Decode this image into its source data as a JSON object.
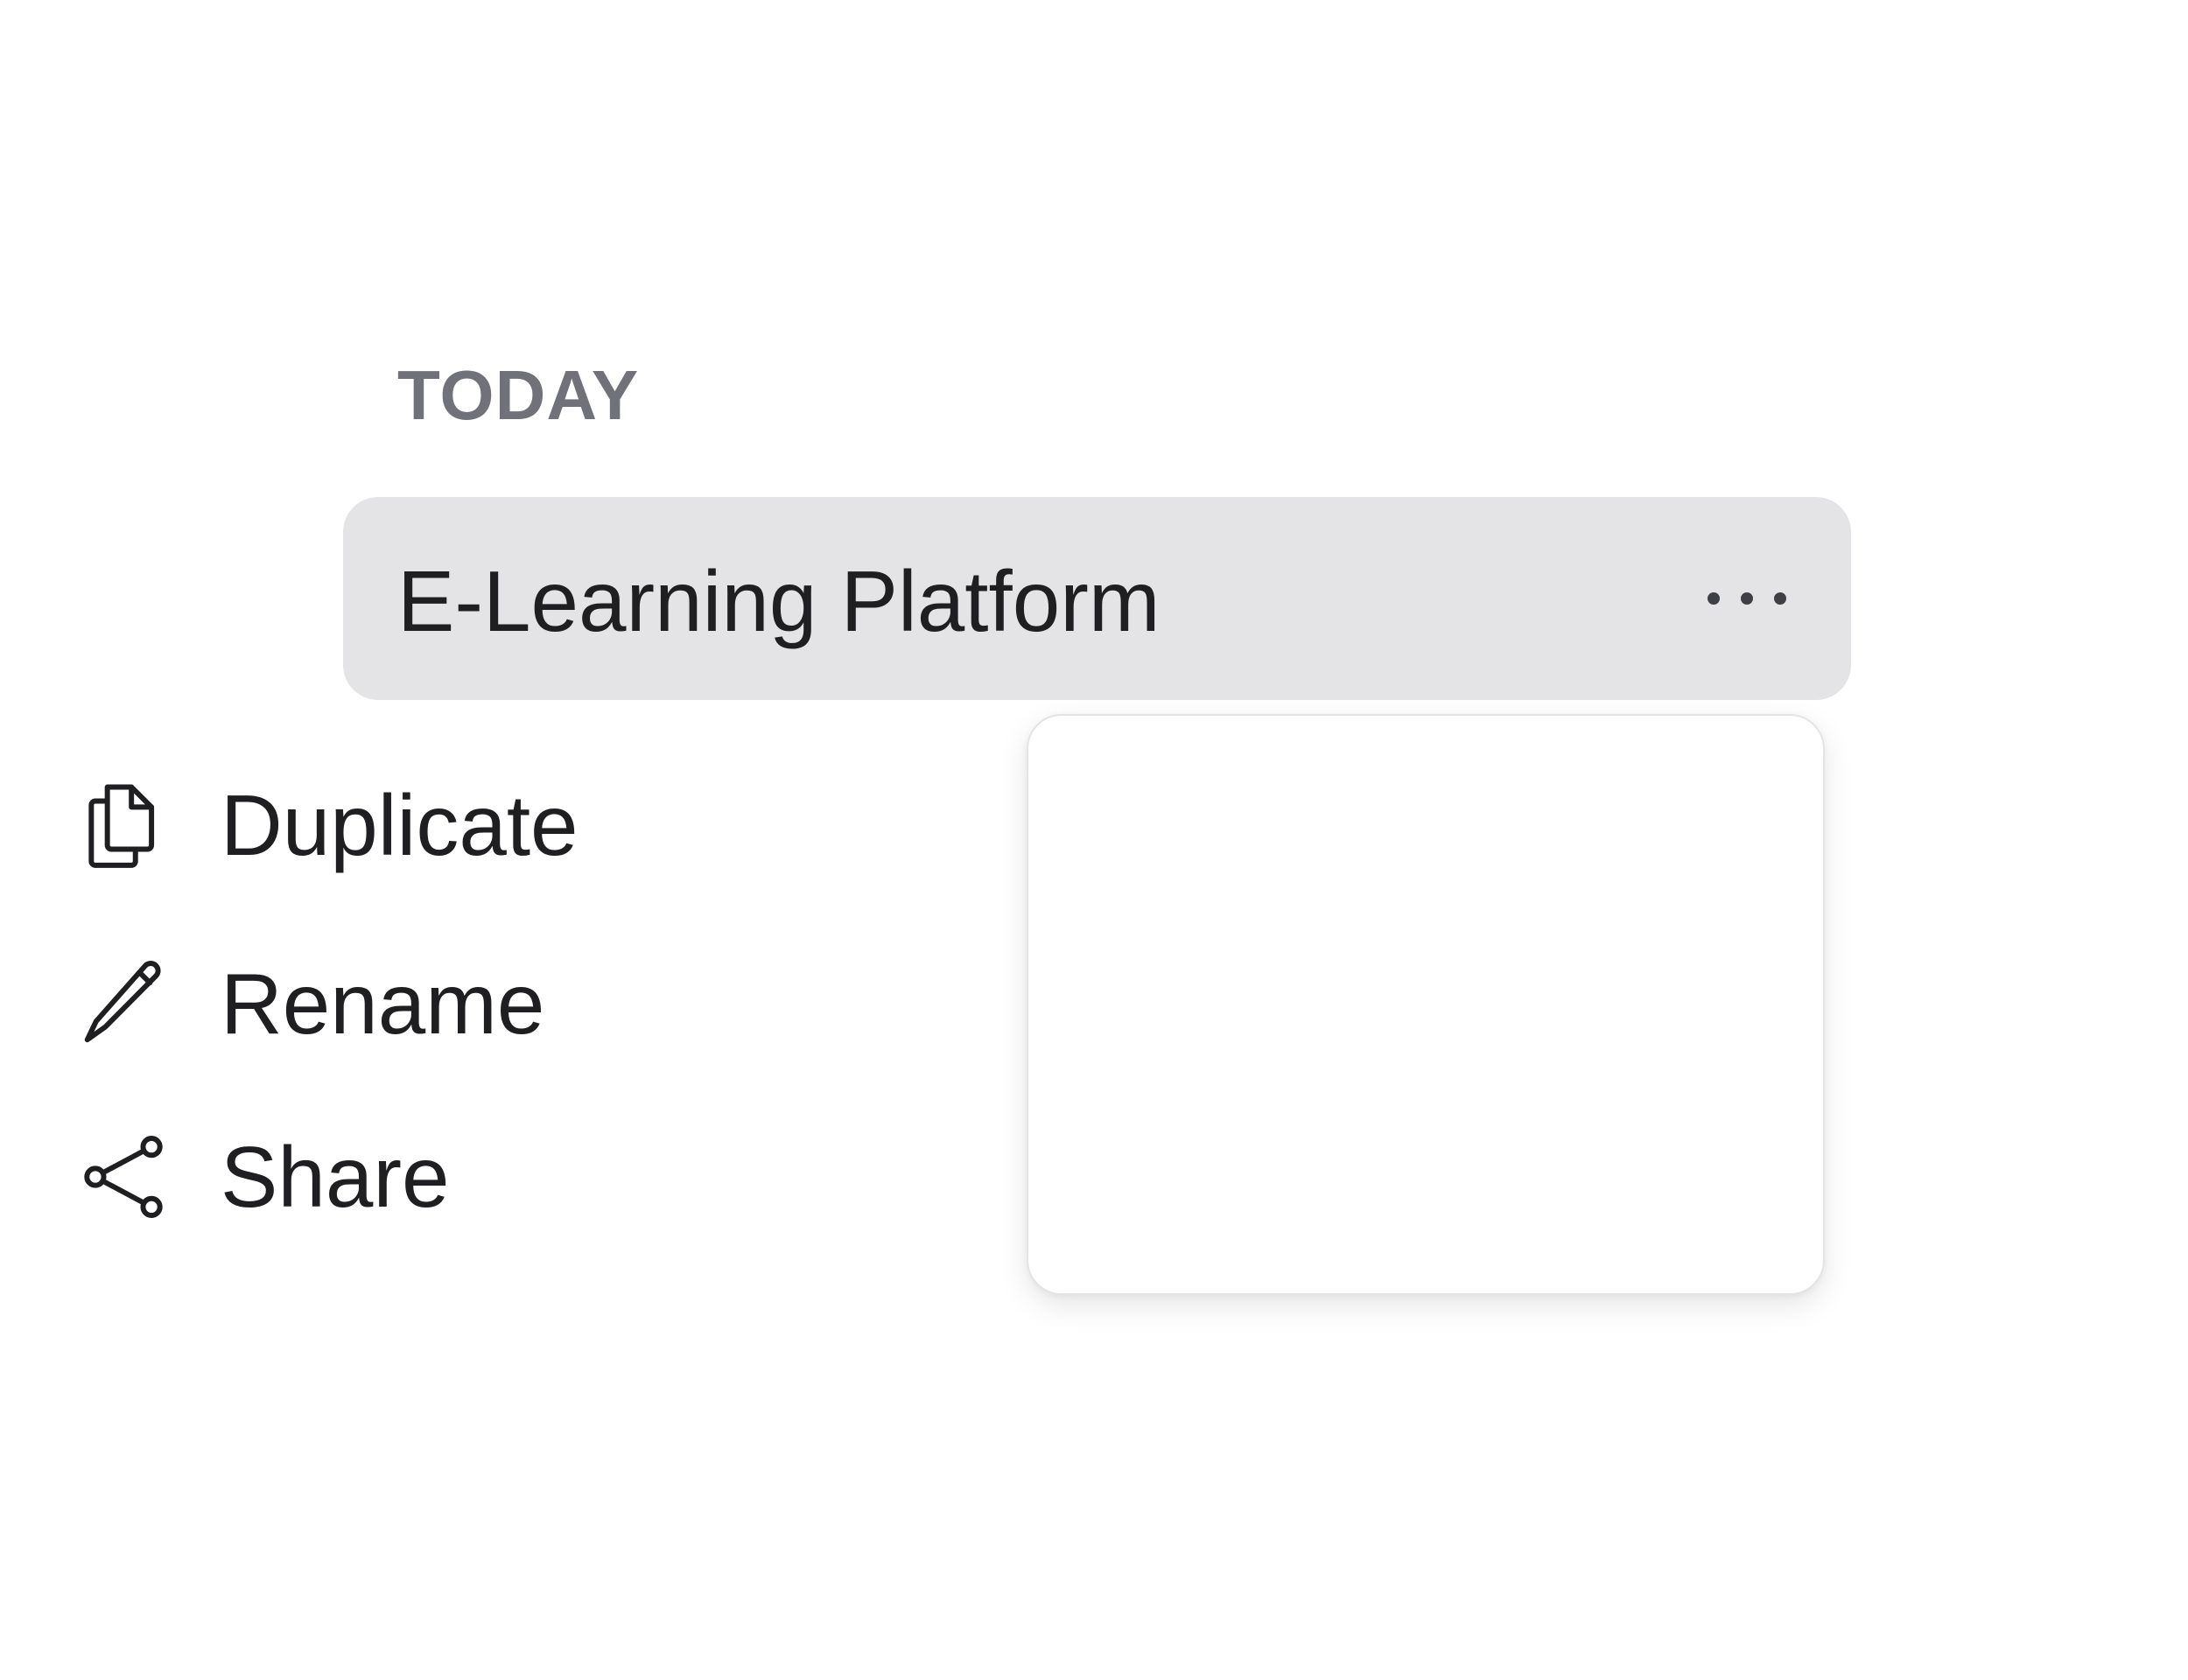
{
  "section": {
    "label": "TODAY"
  },
  "chat_item": {
    "title": "E-Learning Platform",
    "more_icon": "more-horizontal-icon",
    "background": "#e4e4e7"
  },
  "context_menu": {
    "items": [
      {
        "label": "Duplicate",
        "icon": "duplicate-icon"
      },
      {
        "label": "Rename",
        "icon": "pencil-icon"
      },
      {
        "label": "Share",
        "icon": "share-icon"
      }
    ]
  },
  "colors": {
    "text": "#1f1f22",
    "muted": "#71717a",
    "selected_bg": "#e4e4e7"
  }
}
